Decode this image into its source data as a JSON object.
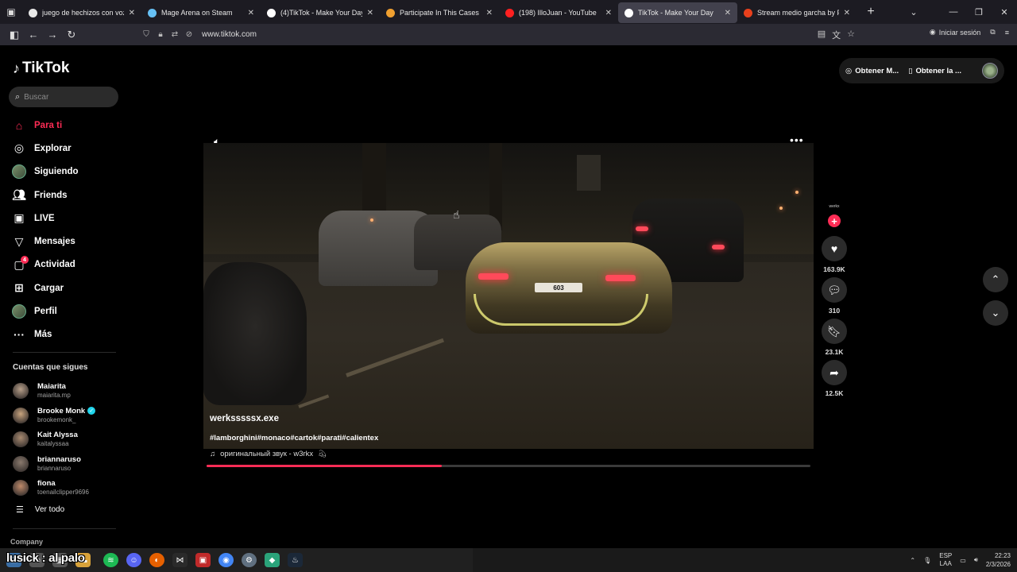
{
  "browser": {
    "tabs": [
      {
        "title": "juego de hechizos con voz - Bu",
        "fav_color": "#e8e8e8",
        "active": false
      },
      {
        "title": "Mage Arena on Steam",
        "fav_color": "#66c0f4",
        "active": false
      },
      {
        "title": "(4)TikTok - Make Your Day",
        "fav_color": "#ffffff",
        "active": false
      },
      {
        "title": "Participate In This Cases Battle!",
        "fav_color": "#f0a030",
        "active": false
      },
      {
        "title": "(198) IlloJuan - YouTube",
        "fav_color": "#ff2020",
        "active": false
      },
      {
        "title": "TikTok - Make Your Day",
        "fav_color": "#ffffff",
        "active": true
      },
      {
        "title": "Stream medio garcha by PelisC",
        "fav_color": "#e8401c",
        "active": false
      }
    ],
    "url": "www.tiktok.com",
    "login_label": "Iniciar sesión"
  },
  "sidebar": {
    "logo": "TikTok",
    "search_placeholder": "Buscar",
    "nav": [
      {
        "label": "Para ti",
        "icon": "home-icon",
        "active": true
      },
      {
        "label": "Explorar",
        "icon": "compass-icon"
      },
      {
        "label": "Siguiendo",
        "icon": "following-avatar"
      },
      {
        "label": "Friends",
        "icon": "friends-icon"
      },
      {
        "label": "LIVE",
        "icon": "live-icon"
      },
      {
        "label": "Mensajes",
        "icon": "messages-icon"
      },
      {
        "label": "Actividad",
        "icon": "activity-icon",
        "badge": "4"
      },
      {
        "label": "Cargar",
        "icon": "upload-icon"
      },
      {
        "label": "Perfil",
        "icon": "profile-avatar"
      },
      {
        "label": "Más",
        "icon": "more-icon"
      }
    ],
    "following_title": "Cuentas que sigues",
    "following": [
      {
        "name": "Maiarita",
        "handle": "maiarita.mp",
        "color": "#b8a08a"
      },
      {
        "name": "Brooke Monk",
        "handle": "brookemonk_",
        "color": "#c9a47e",
        "verified": true
      },
      {
        "name": "Kait Alyssa",
        "handle": "kaitalyssaa",
        "color": "#a88a70"
      },
      {
        "name": "briannaruso",
        "handle": "briannaruso",
        "color": "#8a7a6e"
      },
      {
        "name": "fiona",
        "handle": "toenailclipper9696",
        "color": "#c08a6a"
      }
    ],
    "see_all": "Ver todo",
    "company": "Company"
  },
  "top_actions": {
    "get_coins": "Obtener M...",
    "get_app": "Obtener la ..."
  },
  "video": {
    "author": "werksssssx.exe",
    "hashtags": "#lamborghini#monaco#cartok#parati#calientex",
    "music": "оригинальный звук - w3rkx",
    "plate": "603",
    "progress": 0.39,
    "creator_label": "werkx",
    "likes": "163.9K",
    "comments": "310",
    "saves": "23.1K",
    "shares": "12.5K"
  },
  "taskbar": {
    "overlay_text": "lusick : al palo",
    "lang_top": "ESP",
    "lang_bottom": "LAA",
    "time": "22:23",
    "date": "2/3/2026"
  }
}
